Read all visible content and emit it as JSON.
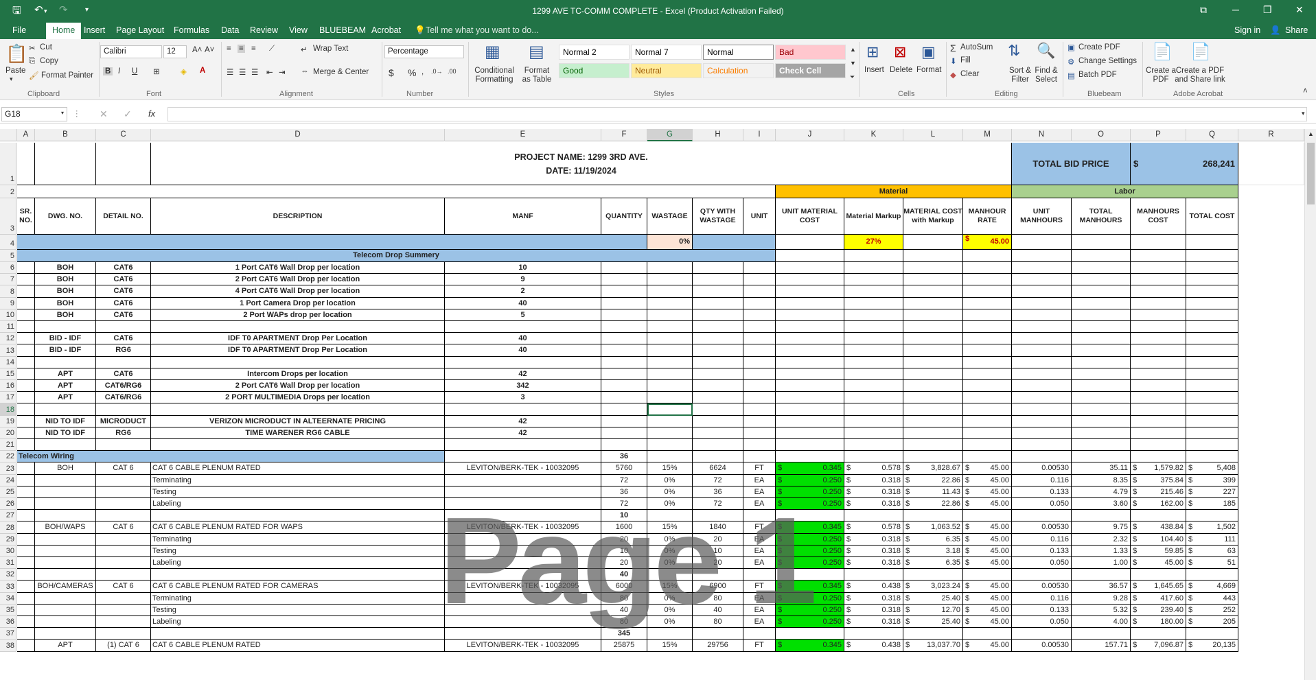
{
  "window": {
    "title": "1299 AVE TC-COMM COMPLETE - Excel (Product Activation Failed)"
  },
  "tabs": [
    "File",
    "Home",
    "Insert",
    "Page Layout",
    "Formulas",
    "Data",
    "Review",
    "View",
    "BLUEBEAM",
    "Acrobat"
  ],
  "tell_me": "Tell me what you want to do...",
  "sign_in": "Sign in",
  "share": "Share",
  "ribbon": {
    "clipboard": {
      "paste": "Paste",
      "cut": "Cut",
      "copy": "Copy",
      "format_painter": "Format Painter",
      "group": "Clipboard"
    },
    "font": {
      "name": "Calibri",
      "size": "12",
      "group": "Font"
    },
    "alignment": {
      "wrap": "Wrap Text",
      "merge": "Merge & Center",
      "group": "Alignment"
    },
    "number": {
      "format": "Percentage",
      "group": "Number"
    },
    "styles": {
      "cond": "Conditional Formatting",
      "fmt_table": "Format as Table",
      "group": "Styles",
      "cells": [
        {
          "label": "Normal 2",
          "bg": "#ffffff",
          "fg": "#000000"
        },
        {
          "label": "Normal 7",
          "bg": "#ffffff",
          "fg": "#000000"
        },
        {
          "label": "Normal",
          "bg": "#ffffff",
          "fg": "#000000"
        },
        {
          "label": "Bad",
          "bg": "#ffc7ce",
          "fg": "#9c0006"
        },
        {
          "label": "Good",
          "bg": "#c6efce",
          "fg": "#006100"
        },
        {
          "label": "Neutral",
          "bg": "#ffeb9c",
          "fg": "#9c5700"
        },
        {
          "label": "Calculation",
          "bg": "#f2f2f2",
          "fg": "#fa7d00"
        },
        {
          "label": "Check Cell",
          "bg": "#a5a5a5",
          "fg": "#ffffff"
        }
      ]
    },
    "cells": {
      "insert": "Insert",
      "delete": "Delete",
      "format": "Format",
      "group": "Cells"
    },
    "editing": {
      "autosum": "AutoSum",
      "fill": "Fill",
      "clear": "Clear",
      "sort": "Sort & Filter",
      "find": "Find & Select",
      "group": "Editing"
    },
    "bluebeam": {
      "create": "Create PDF",
      "settings": "Change Settings",
      "batch": "Batch PDF",
      "group": "Bluebeam"
    },
    "acrobat": {
      "create": "Create a PDF",
      "share": "Create a PDF and Share link",
      "group": "Adobe Acrobat"
    }
  },
  "name_box": "G18",
  "columns": [
    "A",
    "B",
    "C",
    "D",
    "E",
    "F",
    "G",
    "H",
    "I",
    "J",
    "K",
    "L",
    "M",
    "N",
    "O",
    "P",
    "Q",
    "R"
  ],
  "selected_column": "G",
  "header": {
    "project": "PROJECT NAME:  1299 3RD AVE.",
    "date": "DATE: 11/19/2024",
    "total_bid_label": "TOTAL BID PRICE",
    "total_bid_currency": "$",
    "total_bid_value": "268,241",
    "material": "Material",
    "labor": "Labor",
    "col_headers": [
      "SR. NO.",
      "DWG. NO.",
      "DETAIL NO.",
      "DESCRIPTION",
      "MANF",
      "QUANTITY",
      "WASTAGE",
      "QTY WITH WASTAGE",
      "UNIT",
      "UNIT MATERIAL COST",
      "Material Markup",
      "MATERIAL COST with Markup",
      "MANHOUR RATE",
      "UNIT MANHOURS",
      "TOTAL MANHOURS",
      "MANHOURS COST",
      "TOTAL COST"
    ],
    "wastage_pct": "0%",
    "markup_pct": "27%",
    "rate_cur": "$",
    "rate_val": "45.00",
    "summary_title": "Telecom Drop Summery",
    "wiring_title": "Telecom Wiring"
  },
  "summary_rows": [
    {
      "row": "6",
      "dwg": "BOH",
      "detail": "CAT6",
      "desc": "1 Port CAT6 Wall Drop per location",
      "qty": "10"
    },
    {
      "row": "7",
      "dwg": "BOH",
      "detail": "CAT6",
      "desc": "2 Port CAT6 Wall Drop per location",
      "qty": "9"
    },
    {
      "row": "8",
      "dwg": "BOH",
      "detail": "CAT6",
      "desc": "4 Port CAT6 Wall Drop per location",
      "qty": "2"
    },
    {
      "row": "9",
      "dwg": "BOH",
      "detail": "CAT6",
      "desc": "1 Port Camera Drop per location",
      "qty": "40"
    },
    {
      "row": "10",
      "dwg": "BOH",
      "detail": "CAT6",
      "desc": "2 Port WAPs drop per location",
      "qty": "5"
    },
    {
      "row": "11",
      "dwg": "",
      "detail": "",
      "desc": "",
      "qty": ""
    },
    {
      "row": "12",
      "dwg": "BID - IDF",
      "detail": "CAT6",
      "desc": "IDF T0 APARTMENT Drop Per Location",
      "qty": "40"
    },
    {
      "row": "13",
      "dwg": "BID - IDF",
      "detail": "RG6",
      "desc": "IDF T0 APARTMENT Drop Per Location",
      "qty": "40"
    },
    {
      "row": "14",
      "dwg": "",
      "detail": "",
      "desc": "",
      "qty": ""
    },
    {
      "row": "15",
      "dwg": "APT",
      "detail": "CAT6",
      "desc": "Intercom Drops per location",
      "qty": "42"
    },
    {
      "row": "16",
      "dwg": "APT",
      "detail": "CAT6/RG6",
      "desc": "2 Port CAT6 Wall Drop per location",
      "qty": "342"
    },
    {
      "row": "17",
      "dwg": "APT",
      "detail": "CAT6/RG6",
      "desc": "2 PORT MULTIMEDIA  Drops per location",
      "qty": "3"
    },
    {
      "row": "18",
      "dwg": "",
      "detail": "",
      "desc": "",
      "qty": ""
    },
    {
      "row": "19",
      "dwg": "NID TO IDF",
      "detail": "MICRODUCT",
      "desc": "VERIZON MICRODUCT IN ALTEERNATE PRICING",
      "qty": "42"
    },
    {
      "row": "20",
      "dwg": "NID TO IDF",
      "detail": "RG6",
      "desc": "TIME WARENER RG6 CABLE",
      "qty": "42"
    },
    {
      "row": "21",
      "dwg": "",
      "detail": "",
      "desc": "",
      "qty": ""
    }
  ],
  "wiring_head": {
    "row": "22",
    "qty": "36"
  },
  "wiring_rows": [
    {
      "row": "23",
      "type": "item",
      "dwg": "BOH",
      "detail": "CAT 6",
      "desc": "CAT 6 CABLE PLENUM RATED",
      "manf": "LEVITON/BERK-TEK - 10032095",
      "qty": "5760",
      "waste": "15%",
      "qtyw": "6624",
      "unit": "FT",
      "umc": "0.345",
      "mm": "0.578",
      "mcm": "3,828.67",
      "rate": "45.00",
      "um": "0.00530",
      "tm": "35.11",
      "mc": "1,579.82",
      "tc": "5,408"
    },
    {
      "row": "24",
      "type": "item",
      "dwg": "",
      "detail": "",
      "desc": "Terminating",
      "manf": "",
      "qty": "72",
      "waste": "0%",
      "qtyw": "72",
      "unit": "EA",
      "umc": "0.250",
      "mm": "0.318",
      "mcm": "22.86",
      "rate": "45.00",
      "um": "0.116",
      "tm": "8.35",
      "mc": "375.84",
      "tc": "399"
    },
    {
      "row": "25",
      "type": "item",
      "dwg": "",
      "detail": "",
      "desc": "Testing",
      "manf": "",
      "qty": "36",
      "waste": "0%",
      "qtyw": "36",
      "unit": "EA",
      "umc": "0.250",
      "mm": "0.318",
      "mcm": "11.43",
      "rate": "45.00",
      "um": "0.133",
      "tm": "4.79",
      "mc": "215.46",
      "tc": "227"
    },
    {
      "row": "26",
      "type": "item",
      "dwg": "",
      "detail": "",
      "desc": "Labeling",
      "manf": "",
      "qty": "72",
      "waste": "0%",
      "qtyw": "72",
      "unit": "EA",
      "umc": "0.250",
      "mm": "0.318",
      "mcm": "22.86",
      "rate": "45.00",
      "um": "0.050",
      "tm": "3.60",
      "mc": "162.00",
      "tc": "185"
    },
    {
      "row": "27",
      "type": "sub",
      "qty": "10"
    },
    {
      "row": "28",
      "type": "item",
      "dwg": "BOH/WAPS",
      "detail": "CAT 6",
      "desc": "CAT 6 CABLE PLENUM RATED FOR WAPS",
      "manf": "LEVITON/BERK-TEK - 10032095",
      "qty": "1600",
      "waste": "15%",
      "qtyw": "1840",
      "unit": "FT",
      "umc": "0.345",
      "mm": "0.578",
      "mcm": "1,063.52",
      "rate": "45.00",
      "um": "0.00530",
      "tm": "9.75",
      "mc": "438.84",
      "tc": "1,502"
    },
    {
      "row": "29",
      "type": "item",
      "dwg": "",
      "detail": "",
      "desc": "Terminating",
      "manf": "",
      "qty": "20",
      "waste": "0%",
      "qtyw": "20",
      "unit": "EA",
      "umc": "0.250",
      "mm": "0.318",
      "mcm": "6.35",
      "rate": "45.00",
      "um": "0.116",
      "tm": "2.32",
      "mc": "104.40",
      "tc": "111"
    },
    {
      "row": "30",
      "type": "item",
      "dwg": "",
      "detail": "",
      "desc": "Testing",
      "manf": "",
      "qty": "10",
      "waste": "0%",
      "qtyw": "10",
      "unit": "EA",
      "umc": "0.250",
      "mm": "0.318",
      "mcm": "3.18",
      "rate": "45.00",
      "um": "0.133",
      "tm": "1.33",
      "mc": "59.85",
      "tc": "63"
    },
    {
      "row": "31",
      "type": "item",
      "dwg": "",
      "detail": "",
      "desc": "Labeling",
      "manf": "",
      "qty": "20",
      "waste": "0%",
      "qtyw": "20",
      "unit": "EA",
      "umc": "0.250",
      "mm": "0.318",
      "mcm": "6.35",
      "rate": "45.00",
      "um": "0.050",
      "tm": "1.00",
      "mc": "45.00",
      "tc": "51"
    },
    {
      "row": "32",
      "type": "sub",
      "qty": "40"
    },
    {
      "row": "33",
      "type": "item",
      "dwg": "BOH/CAMERAS",
      "detail": "CAT 6",
      "desc": "CAT 6 CABLE PLENUM RATED FOR CAMERAS",
      "manf": "LEVITON/BERK-TEK - 10032095",
      "qty": "6000",
      "waste": "15%",
      "qtyw": "6900",
      "unit": "FT",
      "umc": "0.345",
      "mm": "0.438",
      "mcm": "3,023.24",
      "rate": "45.00",
      "um": "0.00530",
      "tm": "36.57",
      "mc": "1,645.65",
      "tc": "4,669"
    },
    {
      "row": "34",
      "type": "item",
      "dwg": "",
      "detail": "",
      "desc": "Terminating",
      "manf": "",
      "qty": "80",
      "waste": "0%",
      "qtyw": "80",
      "unit": "EA",
      "umc": "0.250",
      "mm": "0.318",
      "mcm": "25.40",
      "rate": "45.00",
      "um": "0.116",
      "tm": "9.28",
      "mc": "417.60",
      "tc": "443"
    },
    {
      "row": "35",
      "type": "item",
      "dwg": "",
      "detail": "",
      "desc": "Testing",
      "manf": "",
      "qty": "40",
      "waste": "0%",
      "qtyw": "40",
      "unit": "EA",
      "umc": "0.250",
      "mm": "0.318",
      "mcm": "12.70",
      "rate": "45.00",
      "um": "0.133",
      "tm": "5.32",
      "mc": "239.40",
      "tc": "252"
    },
    {
      "row": "36",
      "type": "item",
      "dwg": "",
      "detail": "",
      "desc": "Labeling",
      "manf": "",
      "qty": "80",
      "waste": "0%",
      "qtyw": "80",
      "unit": "EA",
      "umc": "0.250",
      "mm": "0.318",
      "mcm": "25.40",
      "rate": "45.00",
      "um": "0.050",
      "tm": "4.00",
      "mc": "180.00",
      "tc": "205"
    },
    {
      "row": "37",
      "type": "sub",
      "qty": "345"
    },
    {
      "row": "38",
      "type": "item",
      "dwg": "APT",
      "detail": "(1) CAT 6",
      "desc": "CAT 6 CABLE PLENUM RATED",
      "manf": "LEVITON/BERK-TEK - 10032095",
      "qty": "25875",
      "waste": "15%",
      "qtyw": "29756",
      "unit": "FT",
      "umc": "0.345",
      "mm": "0.438",
      "mcm": "13,037.70",
      "rate": "45.00",
      "um": "0.00530",
      "tm": "157.71",
      "mc": "7,096.87",
      "tc": "20,135"
    }
  ],
  "watermark": "Page 1",
  "colors": {
    "excel_green": "#217346",
    "material_orange": "#ffc000",
    "labor_green": "#a9d08e",
    "blue_band": "#9bc2e6",
    "yellow": "#ffff00",
    "cell_green": "#00e000",
    "pink": "#fce4d6"
  }
}
